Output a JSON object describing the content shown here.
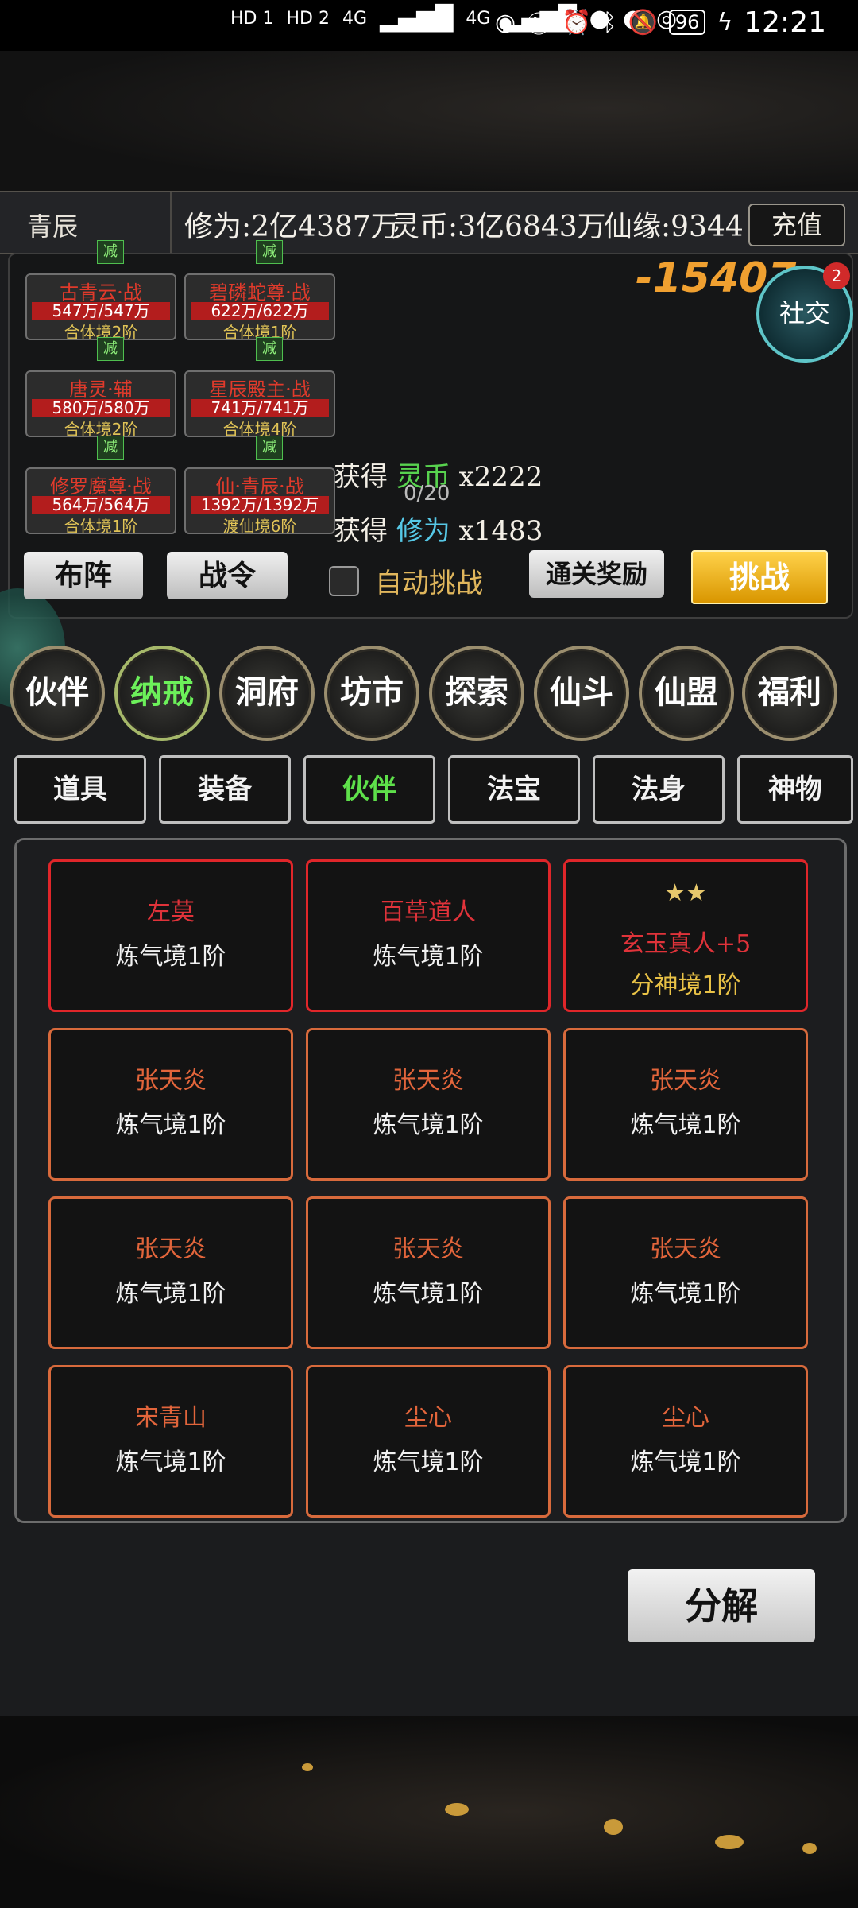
{
  "status_bar": {
    "sim_labels": [
      "HD 1",
      "HD 2"
    ],
    "signal": [
      "4G",
      "4G"
    ],
    "battery": "96",
    "time": "12:21"
  },
  "resources": {
    "player_name": "青辰",
    "cultivation": "修为:2亿4387万",
    "coins": "灵币:3亿6843万",
    "fate": "仙缘:9344",
    "recharge": "充值"
  },
  "battle": {
    "units": [
      {
        "name": "古青云·战",
        "hp": "547万/547万",
        "realm": "合体境2阶"
      },
      {
        "name": "碧磷蛇尊·战",
        "hp": "622万/622万",
        "realm": "合体境1阶"
      },
      {
        "name": "唐灵·辅",
        "hp": "580万/580万",
        "realm": "合体境2阶"
      },
      {
        "name": "星辰殿主·战",
        "hp": "741万/741万",
        "realm": "合体境4阶"
      },
      {
        "name": "修罗魔尊·战",
        "hp": "564万/564万",
        "realm": "合体境1阶"
      },
      {
        "name": "仙·青辰·战",
        "hp": "1392万/1392万",
        "realm": "渡仙境6阶"
      }
    ],
    "minus_label": "减",
    "damage": "-15407",
    "social": {
      "label": "社交",
      "badge": "2"
    },
    "log": [
      {
        "prefix": "获得",
        "type": "灵币",
        "amount": "x2222"
      },
      {
        "prefix": "获得",
        "type": "修为",
        "amount": "x1483"
      }
    ],
    "progress": "0/20",
    "buttons": {
      "formation": "布阵",
      "battle_order": "战令",
      "auto_challenge": "自动挑战",
      "clear_reward": "通关奖励",
      "challenge": "挑战"
    }
  },
  "main_nav": [
    "伙伴",
    "纳戒",
    "洞府",
    "坊市",
    "探索",
    "仙斗",
    "仙盟",
    "福利"
  ],
  "main_nav_active": "纳戒",
  "sub_tabs": [
    "道具",
    "装备",
    "伙伴",
    "法宝",
    "法身",
    "神物"
  ],
  "sub_tab_active": "伙伴",
  "cards": [
    {
      "name": "左莫",
      "realm": "炼气境1阶",
      "rarity": "red"
    },
    {
      "name": "百草道人",
      "realm": "炼气境1阶",
      "rarity": "red"
    },
    {
      "name": "玄玉真人+5",
      "realm": "分神境1阶",
      "rarity": "red",
      "stars": 2
    },
    {
      "name": "张天炎",
      "realm": "炼气境1阶",
      "rarity": "orange"
    },
    {
      "name": "张天炎",
      "realm": "炼气境1阶",
      "rarity": "orange"
    },
    {
      "name": "张天炎",
      "realm": "炼气境1阶",
      "rarity": "orange"
    },
    {
      "name": "张天炎",
      "realm": "炼气境1阶",
      "rarity": "orange"
    },
    {
      "name": "张天炎",
      "realm": "炼气境1阶",
      "rarity": "orange"
    },
    {
      "name": "张天炎",
      "realm": "炼气境1阶",
      "rarity": "orange"
    },
    {
      "name": "宋青山",
      "realm": "炼气境1阶",
      "rarity": "orange"
    },
    {
      "name": "尘心",
      "realm": "炼气境1阶",
      "rarity": "orange"
    },
    {
      "name": "尘心",
      "realm": "炼气境1阶",
      "rarity": "orange"
    }
  ],
  "decompose": "分解",
  "colors": {
    "accent_green": "#5ee04a",
    "card_red": "#e0262a",
    "card_orange": "#d86a3c",
    "gold": "#e9c246"
  }
}
